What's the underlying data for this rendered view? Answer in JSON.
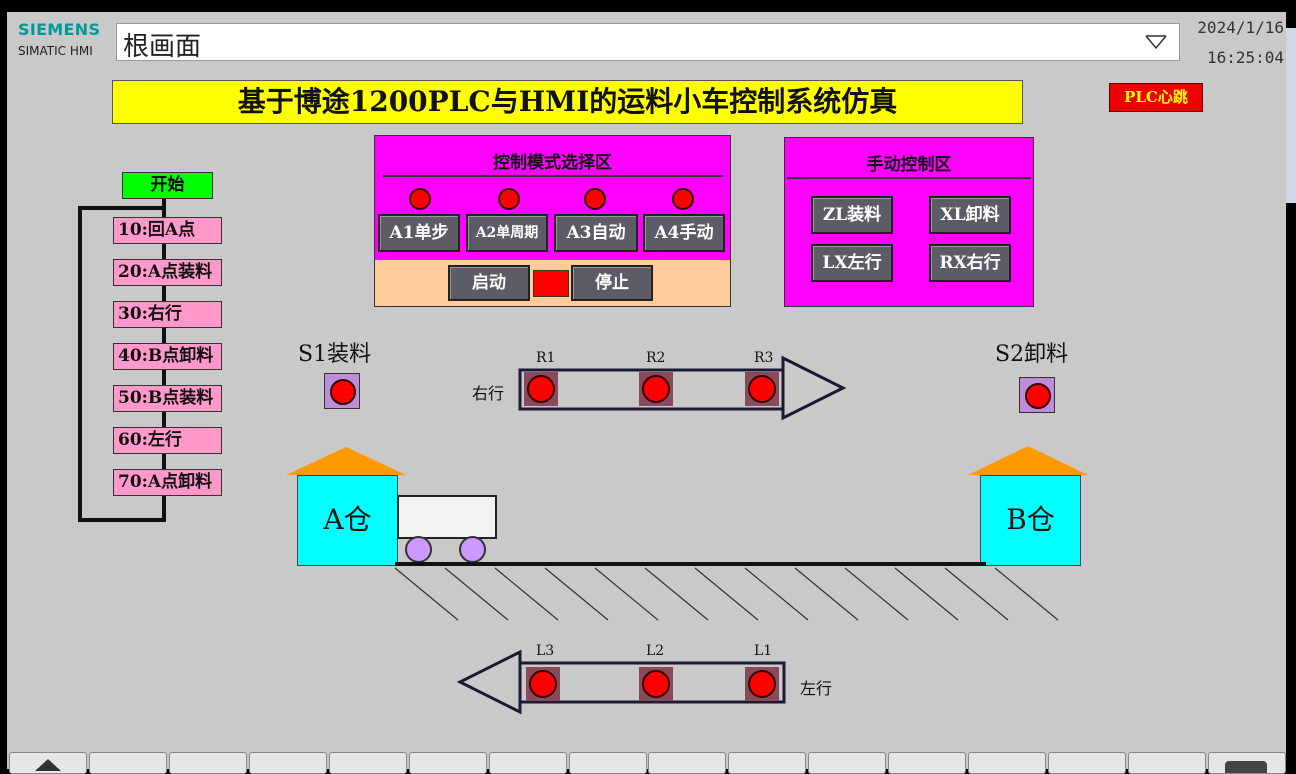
{
  "header": {
    "brand": "SIEMENS",
    "brand_sub": "SIMATIC HMI",
    "screen_name": "根画面",
    "date": "2024/1/16",
    "time": "16:25:04"
  },
  "title": "基于博途1200PLC与HMI的运料小车控制系统仿真",
  "plc_heartbeat": "PLC心跳",
  "mode_panel": {
    "title": "控制模式选择区",
    "modes": [
      "A1单步",
      "A2单周期",
      "A3自动",
      "A4手动"
    ],
    "start": "启动",
    "stop": "停止"
  },
  "manual_panel": {
    "title": "手动控制区",
    "buttons": [
      "ZL装料",
      "XL卸料",
      "LX左行",
      "RX右行"
    ]
  },
  "sequence": {
    "start": "开始",
    "steps": [
      "10:回A点",
      "20:A点装料",
      "30:右行",
      "40:B点卸料",
      "50:B点装料",
      "60:左行",
      "70:A点卸料"
    ]
  },
  "process": {
    "s1": "S1装料",
    "s2": "S2卸料",
    "right_label": "右行",
    "left_label": "左行",
    "right_leds": [
      "R1",
      "R2",
      "R3"
    ],
    "left_leds": [
      "L3",
      "L2",
      "L1"
    ],
    "warehouse_a": "A仓",
    "warehouse_b": "B仓"
  },
  "colors": {
    "background": "#c9c9c9",
    "title_bar": "#ffff00",
    "panel": "#ff00ff",
    "led_on": "#ff0000",
    "step_box": "#ff99cc",
    "start_box": "#00ff00",
    "warehouse": "#00ffff",
    "roof": "#ff9900"
  }
}
